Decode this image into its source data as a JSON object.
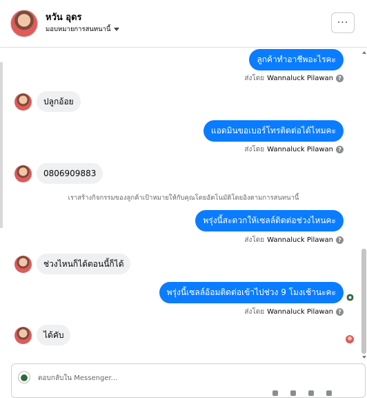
{
  "header": {
    "name": "หวัน อุดร",
    "assign_label": "มอบหมายการสนทนานี้",
    "more_label": "···"
  },
  "messages": {
    "m1": {
      "text": "ลูกค้าทำอาชีพอะไรคะ"
    },
    "m1_sent_prefix": "ส่งโดย",
    "m1_sent_name": "Wannaluck Pilawan",
    "m2": {
      "text": "ปลูกอ้อย"
    },
    "m3": {
      "text": "แอดมินขอเบอร์โทรติดต่อได้ไหมคะ"
    },
    "m3_sent_prefix": "ส่งโดย",
    "m3_sent_name": "Wannaluck Pilawan",
    "m4": {
      "text": "0806909883"
    },
    "system": "เราสร้างกิจกรรมของลูกค้าเป้าหมายให้กับคุณโดยอัตโนมัติโดยอิงตามการสนทนานี้",
    "m5": {
      "text": "พรุ่งนี้สะดวกให้เซลล์ติดต่อช่วงไหนคะ"
    },
    "m5_sent_prefix": "ส่งโดย",
    "m5_sent_name": "Wannaluck Pilawan",
    "m6": {
      "text": "ช่วงไหนก็ได้ตอนนี้ก็ได้"
    },
    "m7": {
      "text": "พรุ่งนี้เซลล์อ้อมติดต่อเข้าไปช่วง 9 โมงเช้านะคะ"
    },
    "m7_sent_prefix": "ส่งโดย",
    "m7_sent_name": "Wannaluck Pilawan",
    "m8": {
      "text": "ได้คับ"
    }
  },
  "composer": {
    "placeholder": "ตอบกลับใน Messenger..."
  },
  "icons": {
    "help": "?"
  }
}
